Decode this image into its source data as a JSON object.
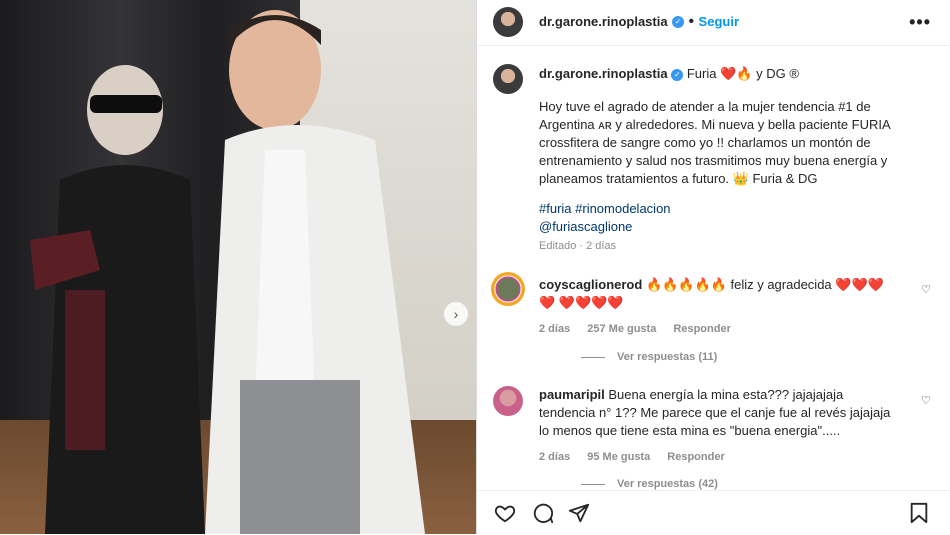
{
  "post": {
    "username": "dr.garone.rinoplastia",
    "follow_label": "Seguir",
    "more_label": "•••",
    "caption_head": "Furia",
    "caption_head_emojis": "❤️🔥",
    "caption_head_tail": "y DG ®",
    "caption_text": "Hoy tuve el agrado de atender a la mujer tendencia #1 de Argentina ᴀʀ y alrededores. Mi nueva y bella paciente FURIA crossfitera de sangre como yo !! charlamos un montón de entrenamiento y salud nos trasmitimos muy buena energía y planeamos tratamientos a futuro. 👑 Furia & DG",
    "hashtags": "#furia #rinomodelacion",
    "mention": "@furiascaglione",
    "edited": "Editado · 2 días"
  },
  "comments": [
    {
      "username": "coyscaglionerod",
      "text": "🔥🔥🔥🔥🔥 feliz y agradecida ❤️❤️❤️❤️ ❤️❤️❤️❤️",
      "time": "2 días",
      "likes": "257 Me gusta",
      "reply": "Responder",
      "replies": "Ver respuestas (11)"
    },
    {
      "username": "paumaripil",
      "text": "Buena energía la mina esta??? jajajajaja tendencia n° 1?? Me parece que el canje fue al revés jajajaja lo menos que tiene esta mina es \"buena energia\".....",
      "time": "2 días",
      "likes": "95 Me gusta",
      "reply": "Responder",
      "replies": "Ver respuestas (42)"
    }
  ],
  "icons": {
    "verified": "verified-badge-icon",
    "like": "heart-icon",
    "comment": "comment-icon",
    "share": "send-icon",
    "save": "bookmark-icon",
    "carousel": "chevron-right-icon"
  },
  "colors": {
    "accent": "#0095f6",
    "text": "#262626",
    "muted": "#8e8e8e",
    "link": "#00376b"
  }
}
